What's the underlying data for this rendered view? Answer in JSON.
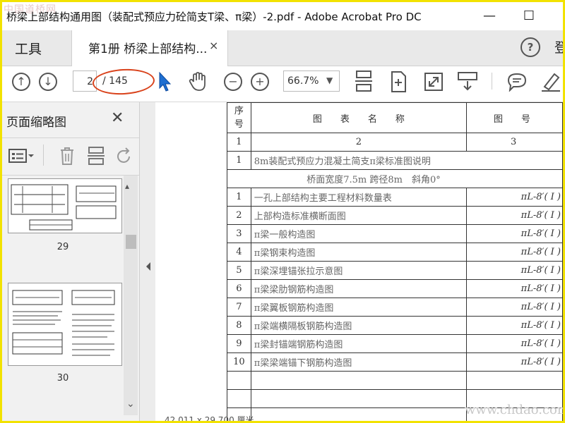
{
  "window": {
    "title": "桥梁上部结构通用图（装配式预应力砼简支T梁、π梁）-2.pdf - Adobe Acrobat Pro DC",
    "watermark_top": "中国道桥网",
    "minimize": "—",
    "maximize": "☐"
  },
  "tabs": {
    "tools": "工具",
    "document": "第1册 桥梁上部结构...",
    "close": "×",
    "help": "?",
    "signin": "登"
  },
  "toolbar": {
    "page_current": "2",
    "page_total": "/ 145",
    "zoom": "66.7%",
    "zoom_caret": "▼"
  },
  "left_panel": {
    "title": "页面缩略图",
    "close": "✕",
    "thumbnails": [
      {
        "label": "29"
      },
      {
        "label": "30"
      }
    ],
    "scroll_down": "⌄"
  },
  "document": {
    "header": {
      "col1": "序\n号",
      "col2": "图　　表　　名　　称",
      "col3": "图　　号"
    },
    "index_row": {
      "col1": "1",
      "col2": "2",
      "col3": "3"
    },
    "section_row": {
      "col1": "1",
      "col2": "8m装配式预应力混凝土简支π梁标准图说明"
    },
    "sub_header": "桥面宽度7.5m 跨径8m　斜角0°",
    "rows": [
      {
        "no": "1",
        "name": "一孔上部结构主要工程材料数量表",
        "code": "πL-8′( Ⅰ )"
      },
      {
        "no": "2",
        "name": "上部构造标准横断面图",
        "code": "πL-8′( Ⅰ )"
      },
      {
        "no": "3",
        "name": "π梁一般构造图",
        "code": "πL-8′( Ⅰ )"
      },
      {
        "no": "4",
        "name": "π梁钢束构造图",
        "code": "πL-8′( Ⅰ )"
      },
      {
        "no": "5",
        "name": "π梁深埋锚张拉示意图",
        "code": "πL-8′( Ⅰ )"
      },
      {
        "no": "6",
        "name": "π梁梁肋钢筋构造图",
        "code": "πL-8′( Ⅰ )"
      },
      {
        "no": "7",
        "name": "π梁翼板钢筋构造图",
        "code": "πL-8′( Ⅰ )"
      },
      {
        "no": "8",
        "name": "π梁端横隔板钢筋构造图",
        "code": "πL-8′( Ⅰ )"
      },
      {
        "no": "9",
        "name": "π梁封锚端钢筋构造图",
        "code": "πL-8′( Ⅰ )"
      },
      {
        "no": "10",
        "name": "π梁梁端锚下钢筋构造图",
        "code": "πL-8′( Ⅰ )"
      }
    ],
    "watermark": "www.chdao.com",
    "status": "42.011 x 29.700 厘米"
  },
  "colors": {
    "annotation_ellipse": "#d9421b",
    "frame": "#f2e200",
    "cursor": "#1f6fd1"
  }
}
